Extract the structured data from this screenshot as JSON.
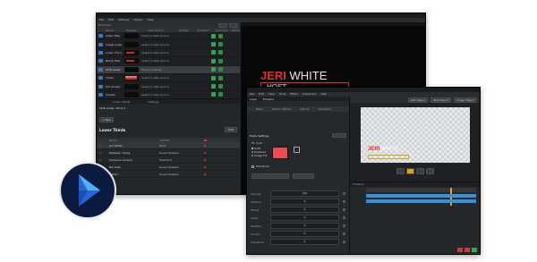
{
  "back_window": {
    "title": "",
    "menu": [
      "File",
      "Edit",
      "Settings",
      "Output",
      "Help"
    ],
    "rundown": {
      "headers": [
        "Name",
        "Preview",
        "Description",
        "Set Key",
        "Duration",
        "Auto Out",
        "Status"
      ],
      "rows": [
        {
          "name": "Video Title",
          "desc": "Select a data source"
        },
        {
          "name": "Image Lower",
          "desc": "Select a data source"
        },
        {
          "name": "Lower Third",
          "desc": "Select a data source"
        },
        {
          "name": "Name Title",
          "desc": "Select a data source"
        },
        {
          "name": "Shift Lower",
          "desc": "Header (Value)",
          "selected": true
        },
        {
          "name": "Ticker",
          "desc": "Select a data source"
        },
        {
          "name": "Full Screen",
          "desc": "Select a data source"
        },
        {
          "name": "Credits",
          "desc": "Select a data source"
        }
      ],
      "preview_red_label": "HEADLINE"
    },
    "data_panel": {
      "tabs": [
        "Lower Thirds",
        "Settings"
      ],
      "breadcrumb": "Shift Lower: Third A",
      "section_title": "Lower Thirds",
      "add_label": "+ New",
      "edit_label": "Edit",
      "columns": [
        "Name",
        "Subtitle"
      ],
      "items": [
        {
          "name": "Jeri White",
          "sub": "Host"
        },
        {
          "name": "Kathleen Young",
          "sub": "Guest Speaker"
        },
        {
          "name": "Cameron Carlson",
          "sub": "President"
        },
        {
          "name": "Nel Gale",
          "sub": "Guest Speaker"
        },
        {
          "name": "Martin",
          "sub": "Guest Speaker"
        }
      ]
    },
    "program": {
      "name": "JERI",
      "name2": " WHITE",
      "subtitle": "HOST",
      "accent": "#e0312f"
    }
  },
  "front_window": {
    "title": "",
    "menu": [
      "File",
      "Edit",
      "View",
      "Tools",
      "Effect",
      "Alignment",
      "Help"
    ],
    "tabs": [
      "Layer",
      "Timeline"
    ],
    "props_tabs": [
      "Basic",
      "Motion Effects",
      "Effects",
      "Transition"
    ],
    "mode_settings": "Mode Settings",
    "solid_label": "Fill Solid",
    "radio_options": [
      "Solid",
      "Gradient",
      "Image Fill"
    ],
    "transform_label": "Transform",
    "field_labels": [
      "Opacity",
      "Position",
      "Offset",
      "Scale",
      "Rotation",
      "Anchor",
      "Transform"
    ],
    "field_values": [
      "100",
      "0",
      "0",
      "0",
      "0",
      "0",
      "0"
    ],
    "preview_name": "JERI",
    "preview_name2": " WHITE",
    "timeline_label": "Timeline",
    "toolbar_buttons": [
      "Add Object",
      "Text Object",
      "Image Object"
    ]
  },
  "logo": {
    "bg": "#0b1a3f",
    "color1": "#2a64d6",
    "color2": "#4fb2f5"
  }
}
